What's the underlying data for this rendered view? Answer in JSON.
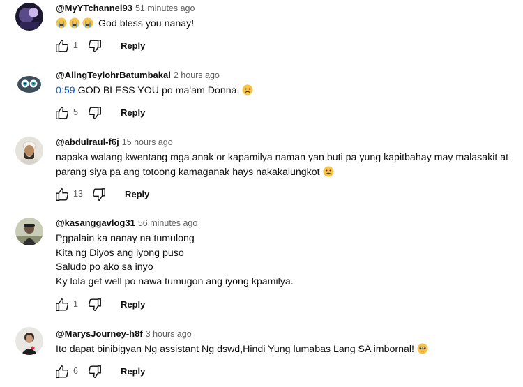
{
  "comments": [
    {
      "handle": "@MyYTchannel93",
      "time": "51 minutes ago",
      "text": "God bless you nanay!",
      "likes": "1",
      "reply_label": "Reply",
      "emoji": [
        "sob-emoji",
        "sob-emoji",
        "sob-emoji"
      ]
    },
    {
      "handle": "@AlingTeylohrBatumbakal",
      "time": "2 hours ago",
      "timestamp_link": "0:59",
      "text": "GOD BLESS YOU po ma'am Donna.",
      "likes": "5",
      "reply_label": "Reply",
      "emoji": [
        "sad-emoji"
      ]
    },
    {
      "handle": "@abdulraul-f6j",
      "time": "15 hours ago",
      "lines": [
        "napaka walang kwentang mga anak or kapamilya naman yan buti pa yung kapitbahay may malasakit at",
        "parang siya pa ang totoong kamaganak hays  nakakalungkot"
      ],
      "likes": "13",
      "reply_label": "Reply",
      "emoji": [
        "sad-emoji"
      ]
    },
    {
      "handle": "@kasanggavlog31",
      "time": "56 minutes ago",
      "lines": [
        "Pgpalain ka nanay na tumulong",
        "Kita ng Diyos ang iyong puso",
        "Saludo po ako sa inyo",
        "Ky lola get well po nawa tumugon ang iyong kpamilya."
      ],
      "likes": "1",
      "reply_label": "Reply"
    },
    {
      "handle": "@MarysJourney-h8f",
      "time": "3 hours ago",
      "text": "Ito dapat binibigyan Ng assistant Ng dswd,Hindi Yung lumabas Lang SA imbornal!",
      "likes": "6",
      "reply_label": "Reply",
      "emoji": [
        "pleading-emoji"
      ]
    }
  ],
  "icons": {
    "like": "thumbs-up-icon",
    "dislike": "thumbs-down-icon"
  },
  "colors": {
    "handle": "#0f0f0f",
    "meta": "#606060",
    "link": "#065fd4",
    "emoji": "#f5c24a"
  }
}
